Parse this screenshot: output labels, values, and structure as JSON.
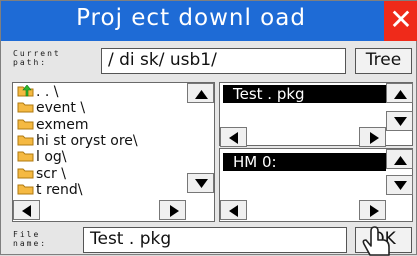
{
  "dialog": {
    "title": "Proj ect  downl oad",
    "close_glyph": "✕"
  },
  "current_path": {
    "label_line1": "Current",
    "label_line2": "path:",
    "value": "/ di sk/ usb1/",
    "tree_button": "Tree"
  },
  "tree": {
    "items": [
      {
        "label": ". . \\",
        "icon": "up-folder-icon"
      },
      {
        "label": "event \\",
        "icon": "folder-icon"
      },
      {
        "label": "exmem",
        "icon": "folder-icon"
      },
      {
        "label": "hi st oryst ore\\",
        "icon": "folder-icon"
      },
      {
        "label": "l og\\",
        "icon": "folder-icon"
      },
      {
        "label": "scr \\",
        "icon": "folder-icon"
      },
      {
        "label": "t rend\\",
        "icon": "folder-icon"
      }
    ]
  },
  "package_list": {
    "items": [
      {
        "label": "Test . pkg"
      }
    ]
  },
  "hmi_list": {
    "items": [
      {
        "label": "HM 0:"
      }
    ]
  },
  "file_name": {
    "label_line1": "File",
    "label_line2": "name:",
    "value": "Test . pkg",
    "ok_button": "OK"
  },
  "colors": {
    "title_bar": "#1e6bd6",
    "close_button": "#ef2a1a",
    "selection": "#000000",
    "folder": "#f5b942"
  }
}
